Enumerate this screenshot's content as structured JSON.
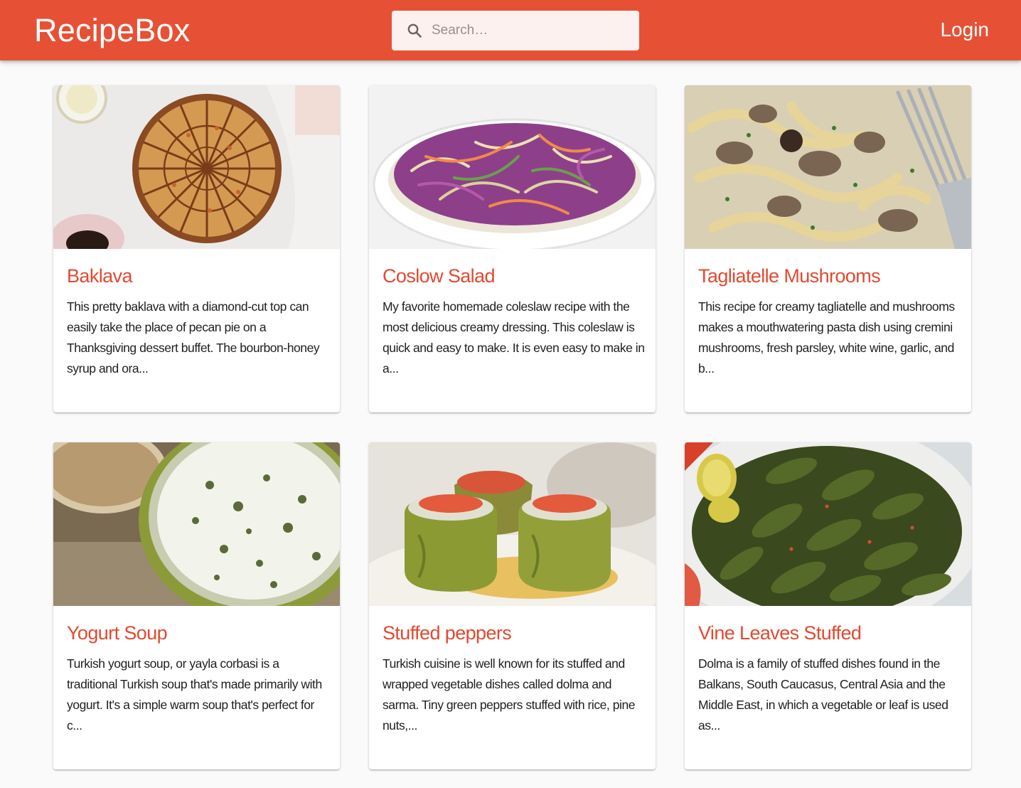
{
  "app": {
    "title": "RecipeBox",
    "login_label": "Login"
  },
  "search": {
    "placeholder": "Search…",
    "value": ""
  },
  "icons": {
    "search": "search-icon"
  },
  "colors": {
    "appbar": "#e65136",
    "recipe_title": "#e24a30",
    "background": "#fafafa"
  },
  "recipes": [
    {
      "title": "Baklava",
      "description": "This pretty baklava with a diamond-cut top can easily take the place of pecan pie on a Thanksgiving dessert buffet. The bourbon-honey syrup and ora..."
    },
    {
      "title": "Coslow Salad",
      "description": "My favorite homemade coleslaw recipe with the most delicious creamy dressing. This coleslaw is quick and easy to make. It is even easy to make in a..."
    },
    {
      "title": "Tagliatelle Mushrooms",
      "description": "This recipe for creamy tagliatelle and mushrooms makes a mouthwatering pasta dish using cremini mushrooms, fresh parsley, white wine, garlic, and b..."
    },
    {
      "title": "Yogurt Soup",
      "description": "Turkish yogurt soup, or yayla corbasi is a traditional Turkish soup that's made primarily with yogurt. It's a simple warm soup that's perfect for c..."
    },
    {
      "title": "Stuffed peppers",
      "description": "Turkish cuisine is well known for its stuffed and wrapped vegetable dishes called dolma and sarma. Tiny green peppers stuffed with rice, pine nuts,..."
    },
    {
      "title": "Vine Leaves Stuffed",
      "description": "Dolma is a family of stuffed dishes found in the Balkans, South Caucasus, Central Asia and the Middle East, in which a vegetable or leaf is used as..."
    }
  ]
}
